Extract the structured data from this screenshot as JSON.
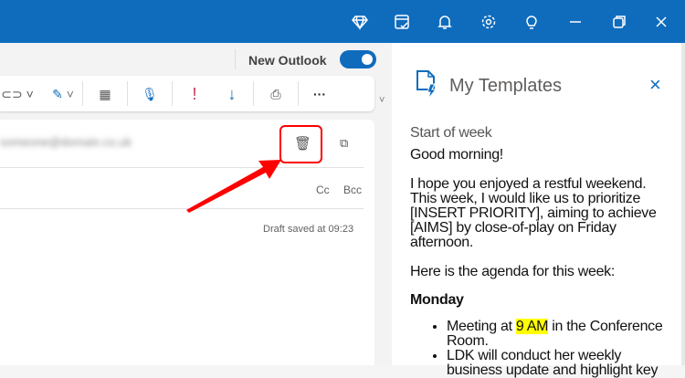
{
  "topbar": {
    "icons": [
      "premium-diamond-icon",
      "my-day-icon",
      "bell-icon",
      "gear-icon",
      "lightbulb-icon",
      "minimize-icon",
      "restore-icon",
      "close-icon"
    ]
  },
  "header": {
    "new_outlook_label": "New Outlook",
    "new_outlook_on": true
  },
  "toolbar": {
    "more_label": "···"
  },
  "compose": {
    "recipient_blurred": "someone@domain.co.uk",
    "cc_label": "Cc",
    "bcc_label": "Bcc",
    "draft_status": "Draft saved at 09:23"
  },
  "panel": {
    "title": "My Templates",
    "template_name": "Start of week",
    "greeting": "Good morning!",
    "paragraph": "I hope you enjoyed a restful weekend. This week, I would like us to prioritize [INSERT PRIORITY], aiming to achieve [AIMS] by close-of-play on Friday afternoon.",
    "agenda_intro": "Here is the agenda for this week:",
    "day": "Monday",
    "item1_pre": "Meeting at ",
    "item1_highlight": "9 AM",
    "item1_post": " in the Conference Room.",
    "item2": "LDK will conduct her weekly business update and highlight key"
  },
  "colors": {
    "brand": "#0f6cbd",
    "annotation": "#ff0000",
    "highlight": "#ffff00"
  }
}
